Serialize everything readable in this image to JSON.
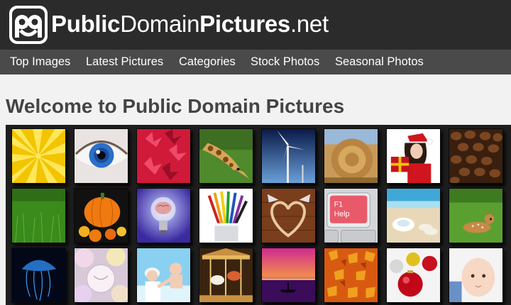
{
  "site": {
    "name_bold1": "Public",
    "name_light1": "Domain",
    "name_bold2": "Pictures",
    "name_light2": ".net",
    "logo_icon": "pdp-logo-icon"
  },
  "nav": {
    "items": [
      {
        "label": "Top Images"
      },
      {
        "label": "Latest Pictures"
      },
      {
        "label": "Categories"
      },
      {
        "label": "Stock Photos"
      },
      {
        "label": "Seasonal Photos"
      }
    ]
  },
  "main": {
    "heading": "Welcome to Public Domain Pictures",
    "thumbnails": [
      {
        "subject": "yellow-sunburst"
      },
      {
        "subject": "blue-eye"
      },
      {
        "subject": "red-leaves"
      },
      {
        "subject": "giraffe"
      },
      {
        "subject": "wind-turbine"
      },
      {
        "subject": "hay-bales"
      },
      {
        "subject": "santa-woman-gift"
      },
      {
        "subject": "coffee-beans"
      },
      {
        "subject": "green-grass"
      },
      {
        "subject": "pumpkin"
      },
      {
        "subject": "brain-lightbulb"
      },
      {
        "subject": "colored-pencils"
      },
      {
        "subject": "wooden-heart"
      },
      {
        "subject": "help-key"
      },
      {
        "subject": "beach-shoes"
      },
      {
        "subject": "fawn"
      },
      {
        "subject": "jellyfish"
      },
      {
        "subject": "love-candies"
      },
      {
        "subject": "mother-baby"
      },
      {
        "subject": "carousel"
      },
      {
        "subject": "sunset-boat"
      },
      {
        "subject": "autumn-leaves"
      },
      {
        "subject": "christmas-ornaments"
      },
      {
        "subject": "baby"
      }
    ],
    "help_key_text": "F1\nHelp"
  },
  "colors": {
    "topbar": "#2b2b2b",
    "navbar": "#4a4a4a",
    "page_bg": "#f2f2f2",
    "grid_bg": "#1e1e1e"
  }
}
